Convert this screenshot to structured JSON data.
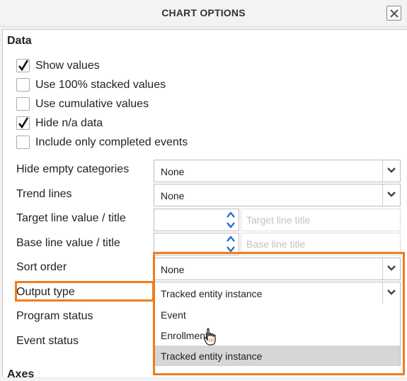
{
  "dialog": {
    "title": "CHART OPTIONS",
    "close_icon": "close-x-icon"
  },
  "data_section": {
    "title": "Data",
    "checkboxes": [
      {
        "label": "Show values",
        "checked": true
      },
      {
        "label": "Use 100% stacked values",
        "checked": false
      },
      {
        "label": "Use cumulative values",
        "checked": false
      },
      {
        "label": "Hide n/a data",
        "checked": true
      },
      {
        "label": "Include only completed events",
        "checked": false
      }
    ],
    "hide_empty_categories": {
      "label": "Hide empty categories",
      "value": "None"
    },
    "trend_lines": {
      "label": "Trend lines",
      "value": "None"
    },
    "target_line": {
      "label": "Target line value / title",
      "value": "",
      "title_placeholder": "Target line title"
    },
    "base_line": {
      "label": "Base line value / title",
      "value": "",
      "title_placeholder": "Base line title"
    },
    "sort_order": {
      "label": "Sort order",
      "value": "None"
    },
    "output_type": {
      "label": "Output type",
      "value": "Tracked entity instance",
      "options": [
        "Event",
        "Enrollment",
        "Tracked entity instance"
      ],
      "highlighted_option": "Tracked entity instance"
    },
    "program_status": {
      "label": "Program status"
    },
    "event_status": {
      "label": "Event status"
    }
  },
  "axes_section": {
    "title": "Axes"
  },
  "colors": {
    "highlight": "#f07c1e",
    "selected_option_bg": "#d6d6d6"
  }
}
